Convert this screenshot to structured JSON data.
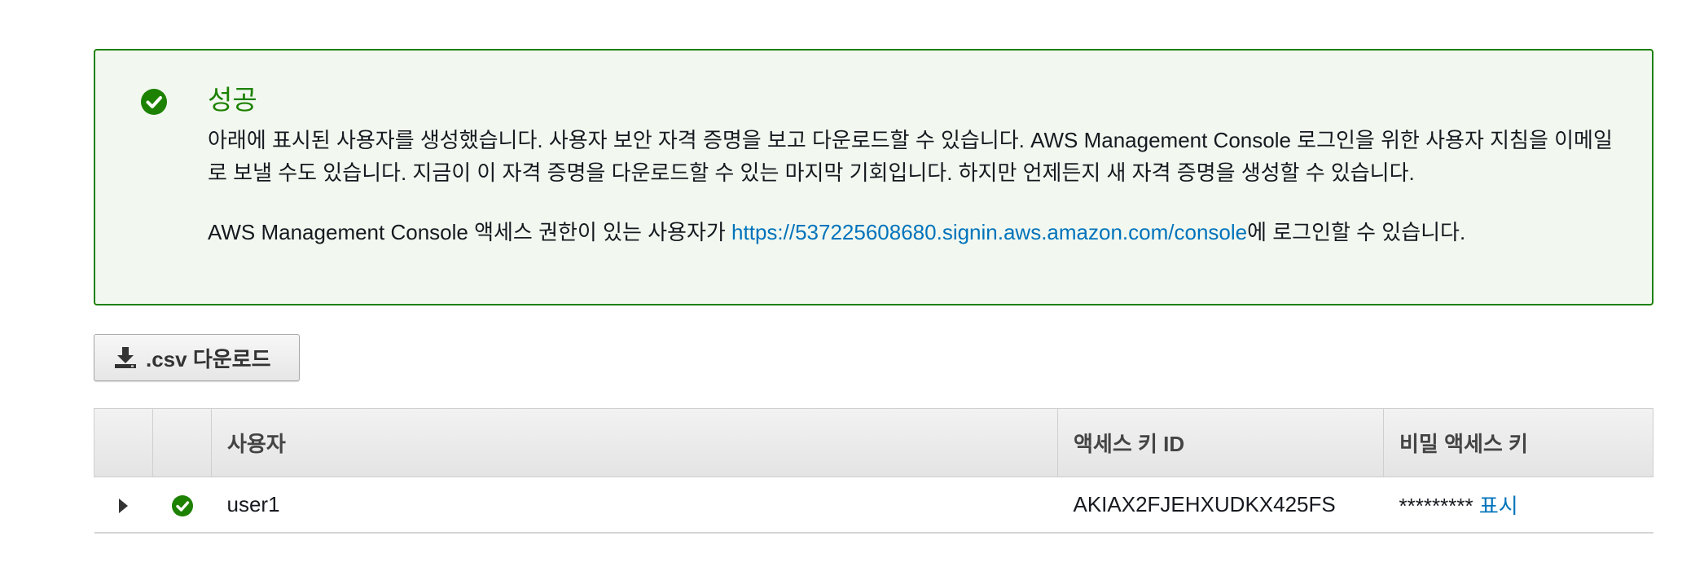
{
  "alert": {
    "title": "성공",
    "message": "아래에 표시된 사용자를 생성했습니다. 사용자 보안 자격 증명을 보고 다운로드할 수 있습니다. AWS Management Console 로그인을 위한 사용자 지침을 이메일로 보낼 수도 있습니다. 지금이 이 자격 증명을 다운로드할 수 있는 마지막 기회입니다. 하지만 언제든지 새 자격 증명을 생성할 수 있습니다.",
    "login_prefix": "AWS Management Console 액세스 권한이 있는 사용자가 ",
    "login_url": "https://537225608680.signin.aws.amazon.com/console",
    "login_suffix": "에 로그인할 수 있습니다.",
    "color": "#1d8102"
  },
  "toolbar": {
    "csv_download_label": ".csv 다운로드",
    "csv_icon": "download-icon"
  },
  "table": {
    "columns": [
      "사용자",
      "액세스 키 ID",
      "비밀 액세스 키"
    ],
    "rows": [
      {
        "user": "user1",
        "access_key_id": "AKIAX2FJEHXUDKX425FS",
        "secret_masked": "*********",
        "show_label": "표시",
        "status_icon": "check-circle-icon"
      }
    ]
  },
  "colors": {
    "link": "#0073bb",
    "success": "#1d8102"
  }
}
